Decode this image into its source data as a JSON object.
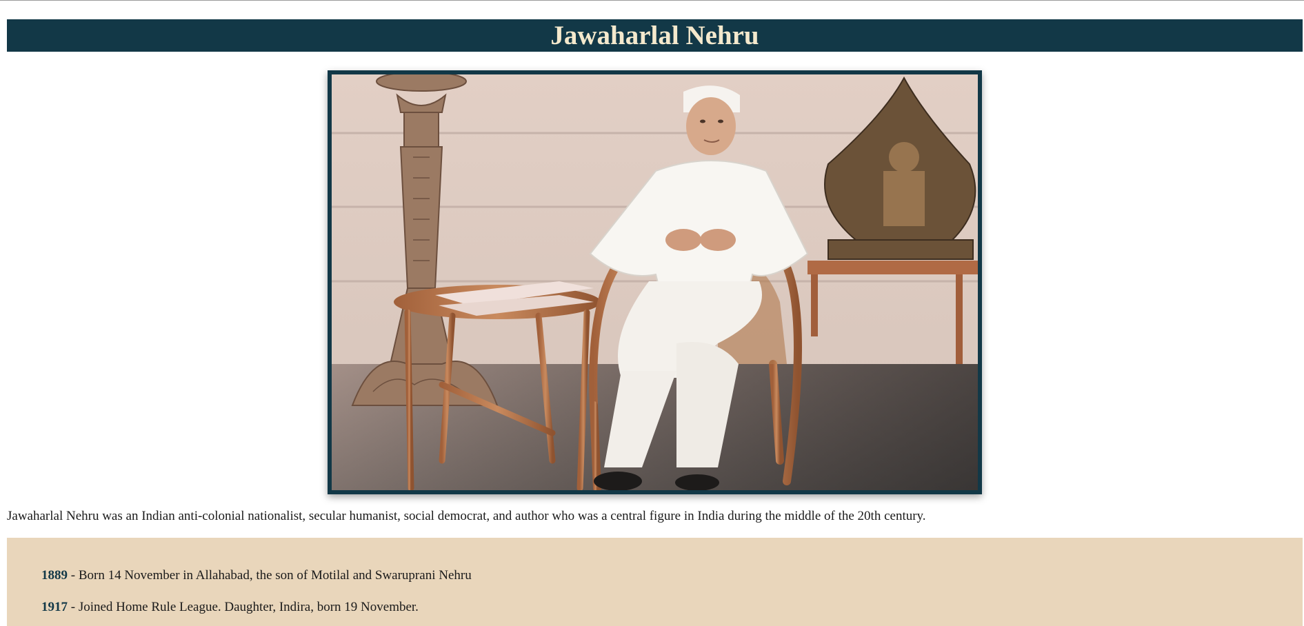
{
  "page": {
    "title": "Jawaharlal Nehru"
  },
  "photo": {
    "subject": "Portrait photograph of Jawaharlal Nehru seated in a cane chair"
  },
  "intro_text": "Jawaharlal Nehru was an Indian anti-colonial nationalist, secular humanist, social democrat, and author who was a central figure in India during the middle of the 20th century.",
  "timeline": {
    "items": [
      {
        "year": "1889",
        "separator": " - ",
        "text": "Born 14 November in Allahabad, the son of Motilal and Swaruprani Nehru"
      },
      {
        "year": "1917",
        "separator": " - ",
        "text": "Joined Home Rule League. Daughter, Indira, born 19 November."
      }
    ]
  },
  "colors": {
    "header_bg": "#123847",
    "header_text": "#f4e9cd",
    "timeline_bg": "#e9d6bb",
    "accent_year": "#123847"
  }
}
